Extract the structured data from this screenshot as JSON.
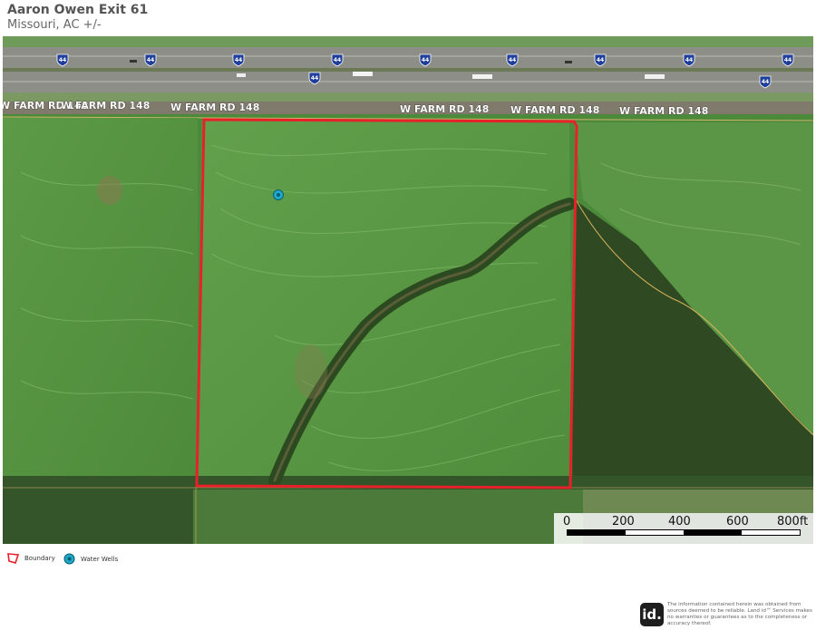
{
  "header": {
    "title": "Aaron Owen Exit 61",
    "subtitle": "Missouri,  AC +/-"
  },
  "map": {
    "road_labels": [
      "W FARM RD 148",
      "W FARM RD 148",
      "W FARM RD 148",
      "W FARM RD 148",
      "W FARM RD 148",
      "W FARM RD 148"
    ],
    "highway_shield": "44",
    "boundary_color": "#e8202a",
    "water_well_color": "#1fa9c9"
  },
  "scale_bar": {
    "labels": [
      "0",
      "200",
      "400",
      "600",
      "800ft"
    ]
  },
  "legend": {
    "boundary_label": "Boundary",
    "water_wells_label": "Water Wells"
  },
  "branding": {
    "logo_text": "id.",
    "disclaimer": "The information contained herein was obtained from sources deemed to be reliable. Land id™ Services makes no warranties or guarantees as to the completeness or accuracy thereof."
  }
}
